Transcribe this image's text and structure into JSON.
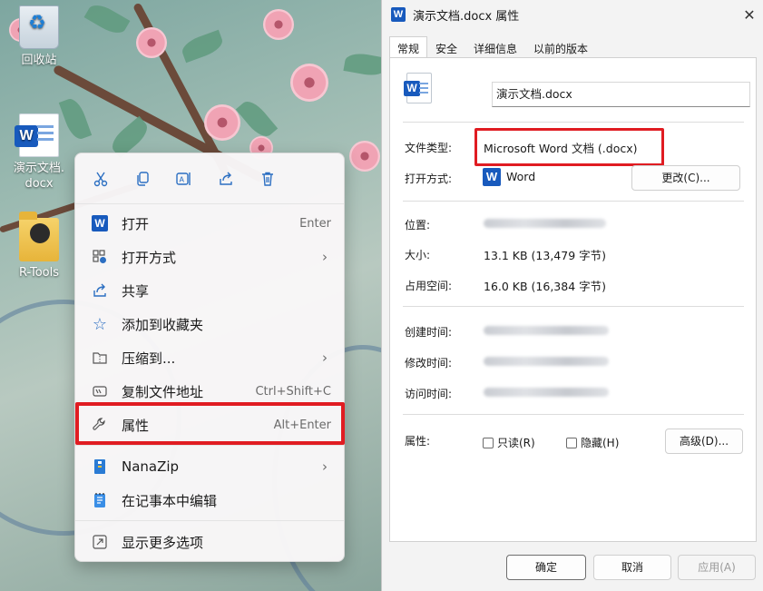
{
  "desktop": {
    "icons": [
      {
        "label": "回收站"
      },
      {
        "label": "演示文档.docx"
      },
      {
        "label": "R-Tools"
      }
    ]
  },
  "context_menu": {
    "toolbar": [
      "cut-icon",
      "copy-icon",
      "rename-icon",
      "share-icon",
      "delete-icon"
    ],
    "items": [
      {
        "label": "打开",
        "shortcut": "Enter",
        "icon": "word-icon"
      },
      {
        "label": "打开方式",
        "arrow": "›",
        "icon": "open-with-icon"
      },
      {
        "label": "共享",
        "icon": "share-icon"
      },
      {
        "label": "添加到收藏夹",
        "icon": "star-icon"
      },
      {
        "label": "压缩到...",
        "arrow": "›",
        "icon": "zip-folder-icon"
      },
      {
        "label": "复制文件地址",
        "shortcut": "Ctrl+Shift+C",
        "icon": "copy-path-icon"
      },
      {
        "label": "属性",
        "shortcut": "Alt+Enter",
        "icon": "wrench-icon"
      },
      {
        "label": "NanaZip",
        "arrow": "›",
        "icon": "nanazip-icon"
      },
      {
        "label": "在记事本中编辑",
        "icon": "notepad-icon"
      },
      {
        "label": "显示更多选项",
        "icon": "more-options-icon"
      }
    ]
  },
  "dialog": {
    "title": "演示文档.docx 属性",
    "tabs": [
      "常规",
      "安全",
      "详细信息",
      "以前的版本"
    ],
    "file_name": "演示文档.docx",
    "labels": {
      "file_type": "文件类型:",
      "open_with": "打开方式:",
      "location": "位置:",
      "size": "大小:",
      "size_on_disk": "占用空间:",
      "created": "创建时间:",
      "modified": "修改时间:",
      "accessed": "访问时间:",
      "attributes": "属性:"
    },
    "values": {
      "file_type": "Microsoft Word 文档 (.docx)",
      "open_with": "Word",
      "size": "13.1 KB (13,479 字节)",
      "size_on_disk": "16.0 KB (16,384 字节)"
    },
    "buttons": {
      "change": "更改(C)...",
      "advanced": "高级(D)...",
      "ok": "确定",
      "cancel": "取消",
      "apply": "应用(A)"
    },
    "checkboxes": {
      "readonly": "只读(R)",
      "hidden": "隐藏(H)"
    }
  },
  "colors": {
    "highlight_red": "#e01c22",
    "word_blue": "#185abd",
    "accent": "#2c6fc2"
  }
}
